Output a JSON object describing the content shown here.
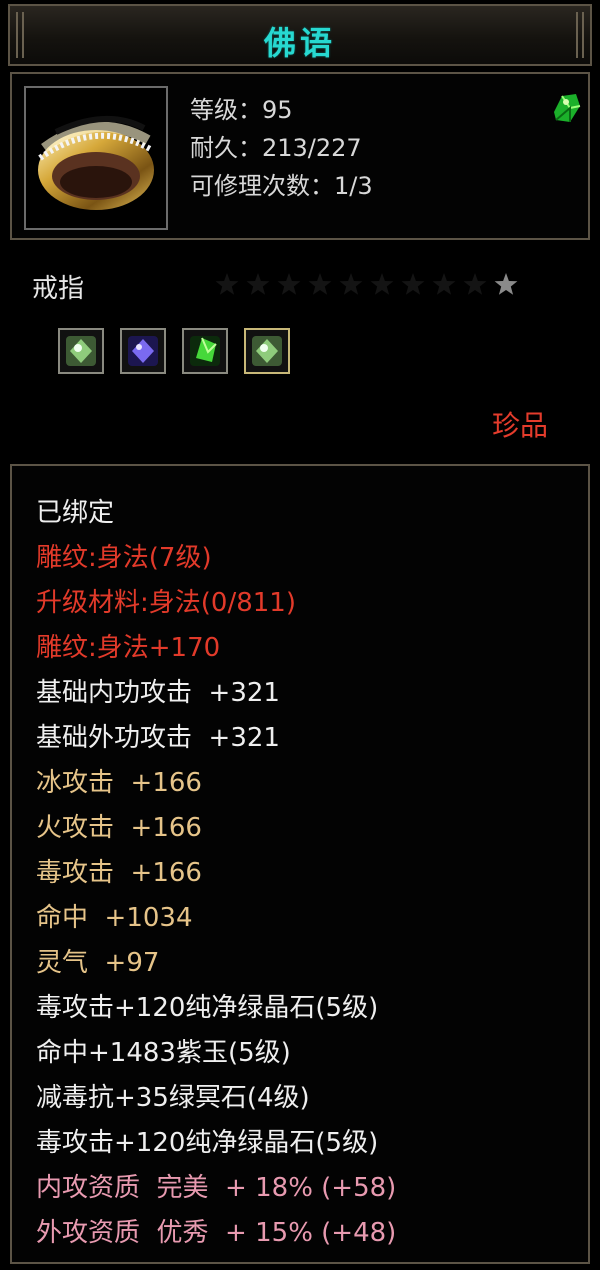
{
  "title": "佛语",
  "item": {
    "level": "等级：95",
    "durability": "耐久：213/227",
    "repairs": "可修理次数：1/3",
    "type": "戒指",
    "grade": "珍品"
  },
  "stars": {
    "total": 10,
    "lit": 1
  },
  "sockets": [
    {
      "gem": "green-crystal-icon",
      "color": "#9ee08a"
    },
    {
      "gem": "purple-jade-icon",
      "color": "#7a6af0"
    },
    {
      "gem": "green-stone-icon",
      "color": "#46d83a"
    },
    {
      "gem": "green-crystal-icon",
      "color": "#9ee08a"
    }
  ],
  "attributes": [
    {
      "text": "已绑定",
      "color": "white"
    },
    {
      "text": "雕纹:身法(7级)",
      "color": "red"
    },
    {
      "text": "升级材料:身法(0/811)",
      "color": "red"
    },
    {
      "text": "雕纹:身法+170",
      "color": "red"
    },
    {
      "text": "基础内功攻击  +321",
      "color": "white"
    },
    {
      "text": "基础外功攻击  +321",
      "color": "white"
    },
    {
      "text": "冰攻击  +166",
      "color": "gold"
    },
    {
      "text": "火攻击  +166",
      "color": "gold"
    },
    {
      "text": "毒攻击  +166",
      "color": "gold"
    },
    {
      "text": "命中  +1034",
      "color": "gold"
    },
    {
      "text": "灵气  +97",
      "color": "gold"
    },
    {
      "text": "毒攻击+120纯净绿晶石(5级)",
      "color": "white"
    },
    {
      "text": "命中+1483紫玉(5级)",
      "color": "white"
    },
    {
      "text": "减毒抗+35绿冥石(4级)",
      "color": "white"
    },
    {
      "text": "毒攻击+120纯净绿晶石(5级)",
      "color": "white"
    },
    {
      "text": "内攻资质  完美  + 18% (+58)",
      "color": "pink"
    },
    {
      "text": "外攻资质  优秀  + 15% (+48)",
      "color": "pink"
    }
  ]
}
